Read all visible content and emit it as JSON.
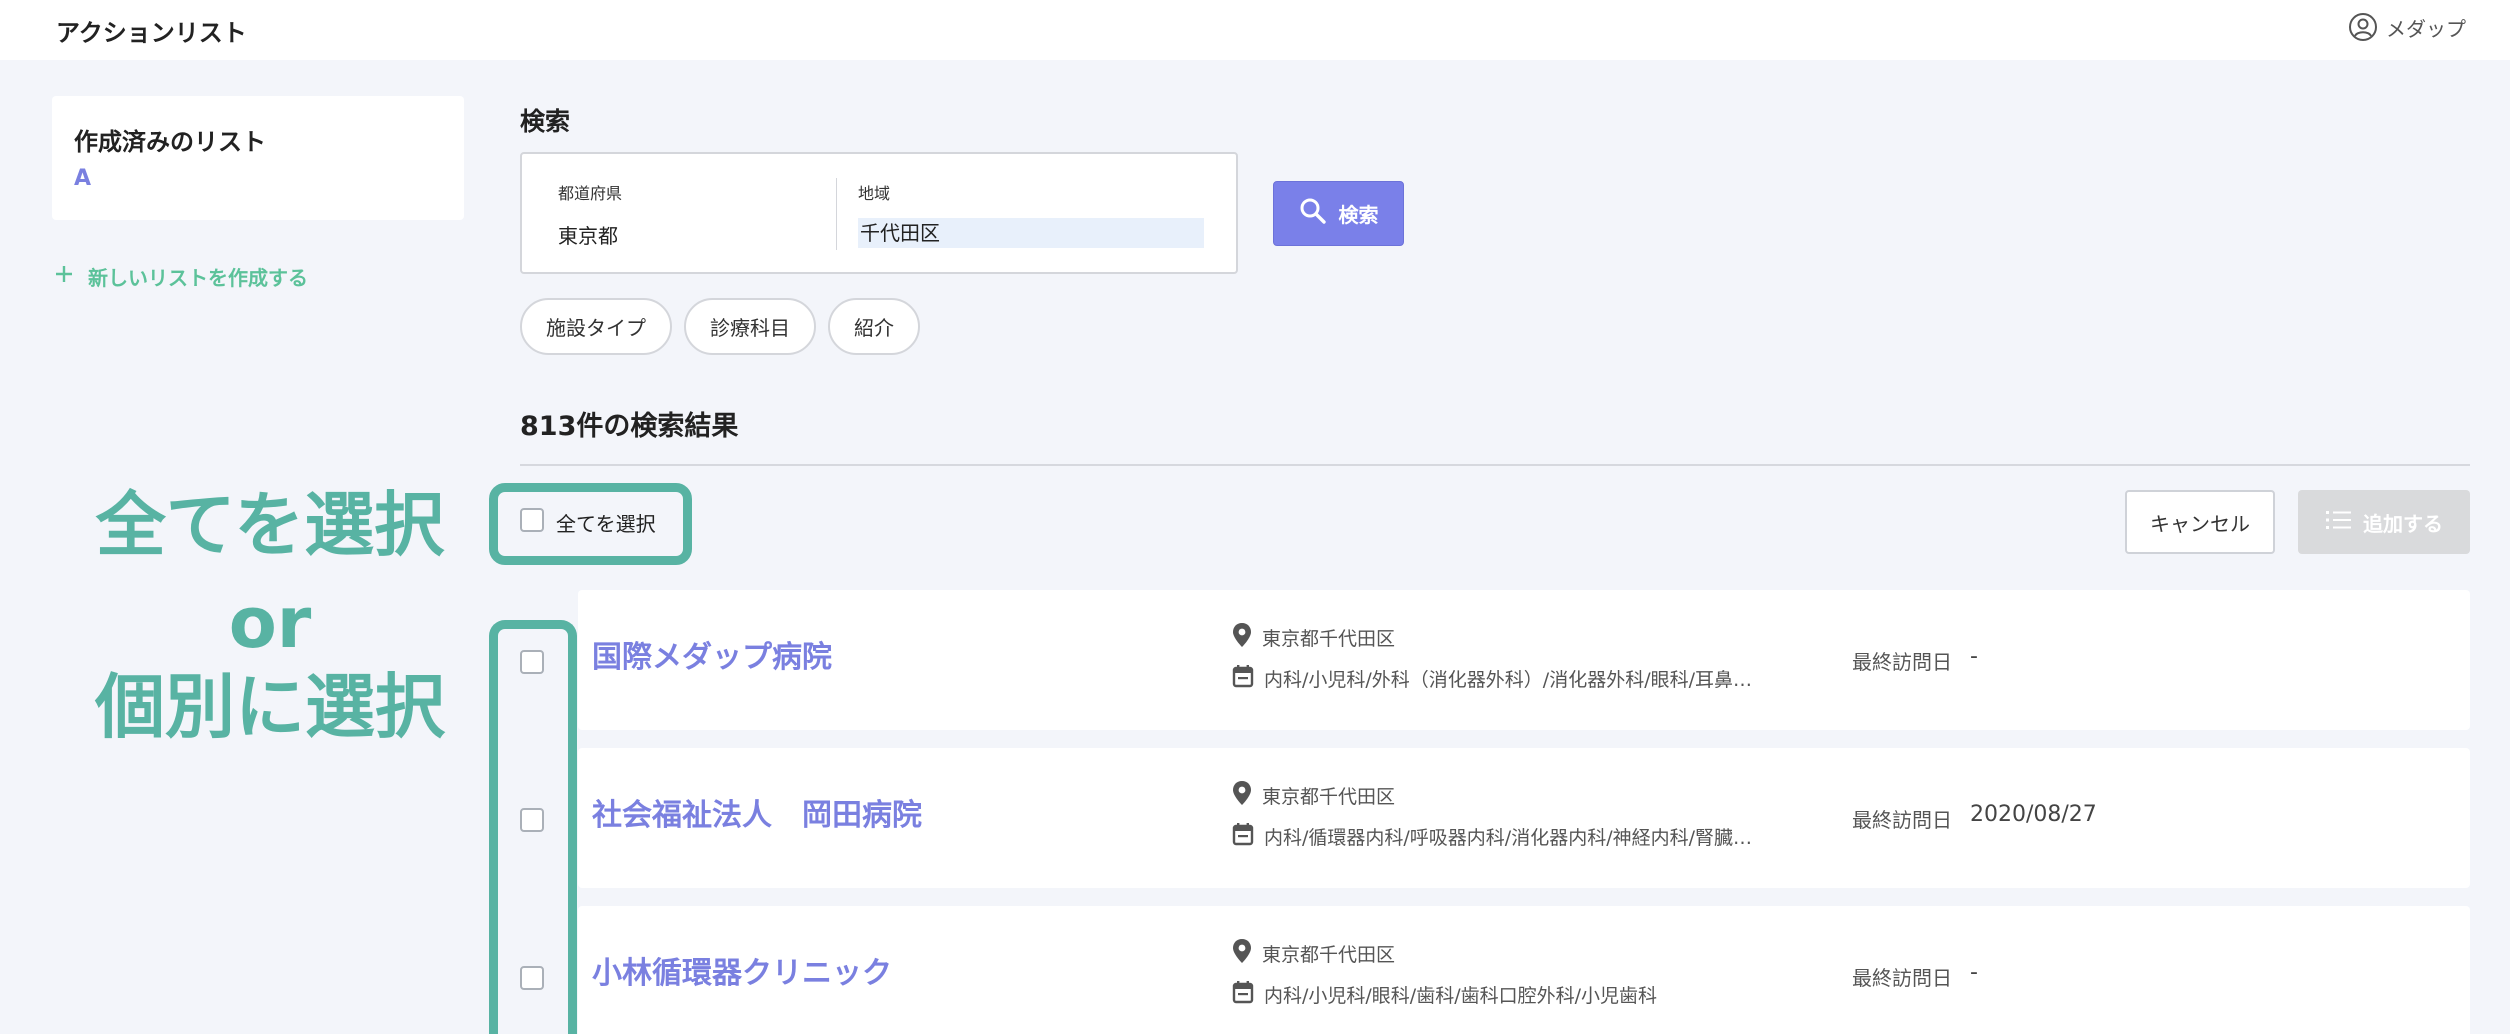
{
  "header": {
    "app_title": "アクションリスト",
    "user_name": "メダップ"
  },
  "sidebar": {
    "list_card_title": "作成済みのリスト",
    "list_items": [
      "A"
    ],
    "new_list_label": "新しいリストを作成する"
  },
  "search": {
    "heading": "検索",
    "prefecture_label": "都道府県",
    "prefecture_value": "東京都",
    "region_label": "地域",
    "region_value": "千代田区",
    "button_label": "検索",
    "chips": [
      "施設タイプ",
      "診療科目",
      "紹介"
    ]
  },
  "results": {
    "heading": "813件の検索結果",
    "select_all_label": "全てを選択",
    "cancel_label": "キャンセル",
    "add_label": "追加する",
    "rows": [
      {
        "name": "国際メダップ病院",
        "address": "東京都千代田区",
        "departments": "内科/小児科/外科（消化器外科）/消化器外科/眼科/耳鼻…",
        "last_visit_label": "最終訪問日",
        "last_visit": "-"
      },
      {
        "name": "社会福祉法人　岡田病院",
        "address": "東京都千代田区",
        "departments": "内科/循環器内科/呼吸器内科/消化器内科/神経内科/腎臓…",
        "last_visit_label": "最終訪問日",
        "last_visit": "2020/08/27"
      },
      {
        "name": "小林循環器クリニック",
        "address": "東京都千代田区",
        "departments": "内科/小児科/眼科/歯科/歯科口腔外科/小児歯科",
        "last_visit_label": "最終訪問日",
        "last_visit": "-"
      }
    ]
  },
  "annotation": {
    "line1": "全てを選択",
    "line2": "or",
    "line3": "個別に選択"
  },
  "colors": {
    "accent": "#7a80e0",
    "annotation": "#58b3a3",
    "new_list": "#5cc29a",
    "disabled_button": "#d9dadc"
  },
  "icons": [
    "user-circle-icon",
    "plus-icon",
    "search-icon",
    "list-icon",
    "map-pin-icon",
    "calendar-icon"
  ]
}
